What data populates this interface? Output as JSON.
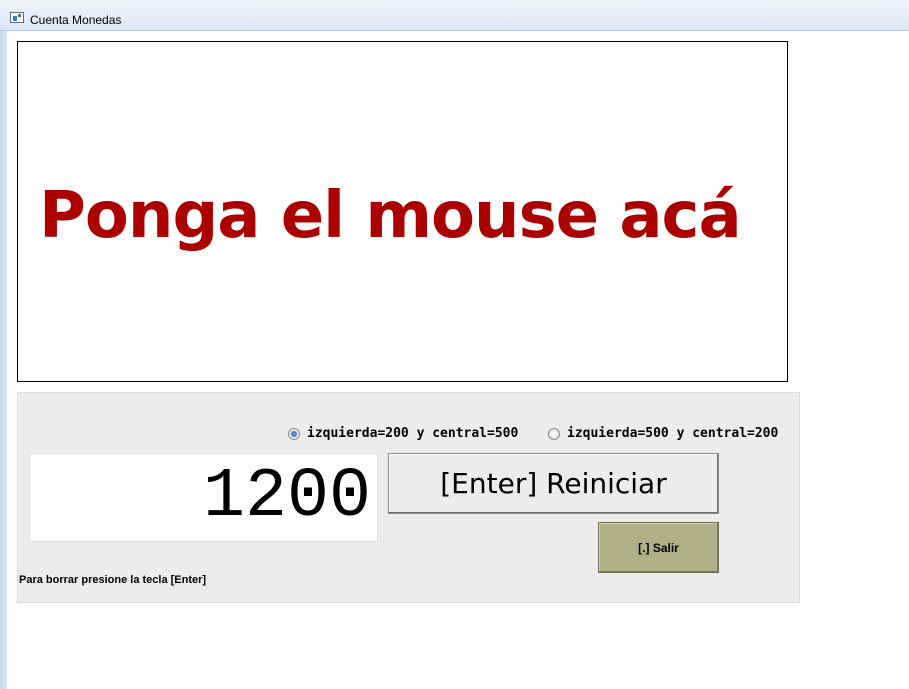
{
  "window": {
    "title": "Cuenta Monedas"
  },
  "mouse_area": {
    "prompt": "Ponga el mouse acá",
    "prompt_color": "#aa0000"
  },
  "options": [
    {
      "label": "izquierda=200 y central=500",
      "selected": true
    },
    {
      "label": "izquierda=500 y central=200",
      "selected": false
    }
  ],
  "counter": {
    "value": "1200"
  },
  "buttons": {
    "reset_label": "[Enter] Reiniciar",
    "exit_label": "[.]  Salir",
    "exit_color": "#b0af86"
  },
  "hint": "Para borrar presione la tecla [Enter]",
  "icons": {
    "app": "app-window-icon"
  }
}
